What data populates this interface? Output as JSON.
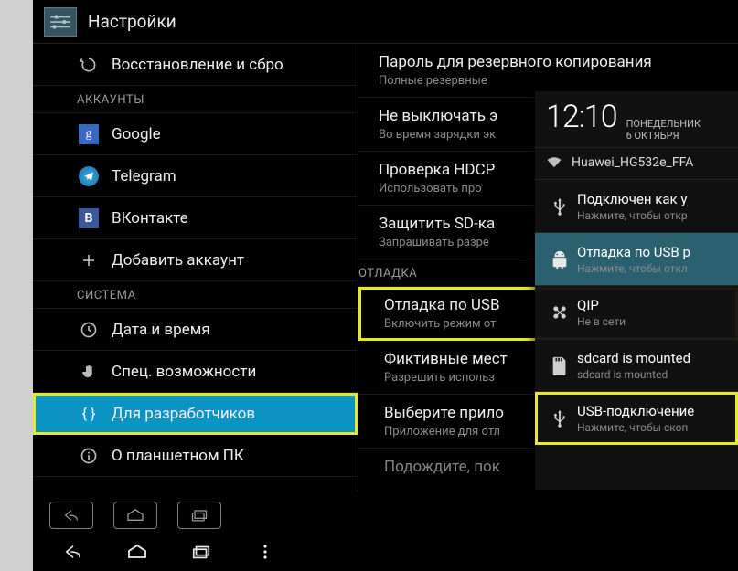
{
  "header": {
    "title": "Настройки"
  },
  "left": {
    "restore": "Восстановление и сбро",
    "section_accounts": "АККАУНТЫ",
    "google": "Google",
    "telegram": "Telegram",
    "vk": "ВКонтакте",
    "add_account": "Добавить аккаунт",
    "section_system": "СИСТЕМА",
    "date_time": "Дата и время",
    "accessibility": "Спец. возможности",
    "developer": "Для разработчиков",
    "about": "О планшетном ПК"
  },
  "right": {
    "backup_pw": {
      "title": "Пароль для резервного копирования",
      "sub": "Полные резервные"
    },
    "stay_awake": {
      "title": "Не выключать э",
      "sub": "Во время зарядки эк"
    },
    "hdcp": {
      "title": "Проверка HDCP",
      "sub": "Использовать про"
    },
    "protect_sd": {
      "title": "Защитить SD-ка",
      "sub": "Запрашивать разре"
    },
    "section_debug": "ОТЛАДКА",
    "usb_debug": {
      "title": "Отладка по USB",
      "sub": "Включить режим от"
    },
    "mock": {
      "title": "Фиктивные мест",
      "sub": "Разрешить использ"
    },
    "debugger": {
      "title": "Выберите прило",
      "sub": "Приложение для отл"
    },
    "wait": {
      "title": "Подождите, пок"
    }
  },
  "notif": {
    "time": "12:10",
    "day": "ПОНЕДЕЛЬНИК",
    "date": "6 ОКТЯБРЯ",
    "wifi": "Huawei_HG532e_FFA",
    "items": [
      {
        "title": "Подключен как у",
        "sub": "Нажмите, чтобы откр",
        "icon": "usb"
      },
      {
        "title": "Отладка по USB р",
        "sub": "Нажмите, чтобы откл",
        "icon": "android"
      },
      {
        "title": "QIP",
        "sub": "Не в сети",
        "icon": "qip"
      },
      {
        "title": "sdcard is mounted",
        "sub": "sdcard is mounted",
        "icon": "sd"
      },
      {
        "title": "USB-подключение",
        "sub": "Нажмите, чтобы скоп",
        "icon": "usb"
      }
    ]
  }
}
